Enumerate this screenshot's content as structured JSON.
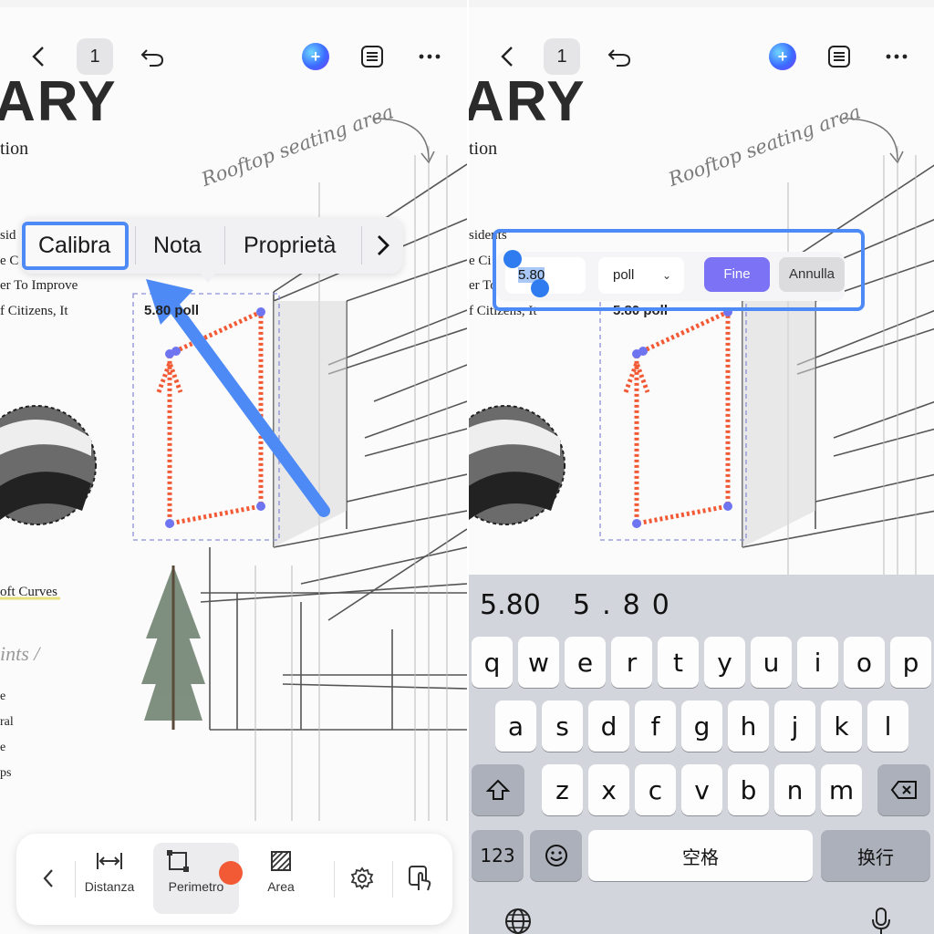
{
  "colors": {
    "accent_blue": "#4e8af5",
    "measure_red": "#f25a35",
    "handle_purple": "#6f74f0",
    "done_button": "#7b72f5",
    "keyboard_bg": "#d3d5dc"
  },
  "left": {
    "topbar": {
      "back_icon": "chevron-left-icon",
      "page_number": "1",
      "undo_icon": "undo-icon",
      "ai_icon": "ai-assistant-icon",
      "outline_icon": "list-icon",
      "more_icon": "more-icon"
    },
    "doc": {
      "title_fragment": "ARY",
      "subtitle_fragment": "tion",
      "handwritten_note": "Rooftop seating area",
      "lines": [
        "sid",
        "e C",
        "er To Improve",
        "f Citizens, It"
      ],
      "curves_text": "oft Curves",
      "ints_text": "ints /",
      "small_lines": [
        "e",
        "ral",
        "e",
        "ps"
      ],
      "measure_value": "5.80 poll"
    },
    "context_menu": {
      "items": [
        "Calibra",
        "Nota",
        "Proprietà"
      ],
      "next_icon": "chevron-right-icon"
    },
    "toolbar": {
      "back_icon": "chevron-left-icon",
      "tools": [
        {
          "label": "Distanza",
          "icon": "distance-icon"
        },
        {
          "label": "Perimetro",
          "icon": "perimeter-icon"
        },
        {
          "label": "Area",
          "icon": "area-icon"
        }
      ],
      "color_icon": "color-swatch-icon",
      "settings_icon": "gear-icon",
      "touch_icon": "touch-mode-icon"
    }
  },
  "right": {
    "topbar": {
      "page_number": "1"
    },
    "doc": {
      "title_fragment": "ARY",
      "subtitle_fragment": "tion",
      "handwritten_note": "Rooftop seating area",
      "lines": [
        "sidents",
        "e Ci",
        "er To",
        "f Citizens, It"
      ],
      "measure_value": "5.80 poll"
    },
    "edit_bar": {
      "value": "5.80",
      "unit": "poll",
      "done_label": "Fine",
      "cancel_label": "Annulla"
    },
    "keyboard": {
      "candidates": [
        "5.80",
        "5.80"
      ],
      "row1": [
        "q",
        "w",
        "e",
        "r",
        "t",
        "y",
        "u",
        "i",
        "o",
        "p"
      ],
      "row2": [
        "a",
        "s",
        "d",
        "f",
        "g",
        "h",
        "j",
        "k",
        "l"
      ],
      "row3": [
        "z",
        "x",
        "c",
        "v",
        "b",
        "n",
        "m"
      ],
      "shift_icon": "shift-icon",
      "backspace_icon": "backspace-icon",
      "numbers_label": "123",
      "emoji_icon": "emoji-icon",
      "space_label": "空格",
      "return_label": "换行",
      "globe_icon": "globe-icon",
      "mic_icon": "microphone-icon"
    }
  }
}
